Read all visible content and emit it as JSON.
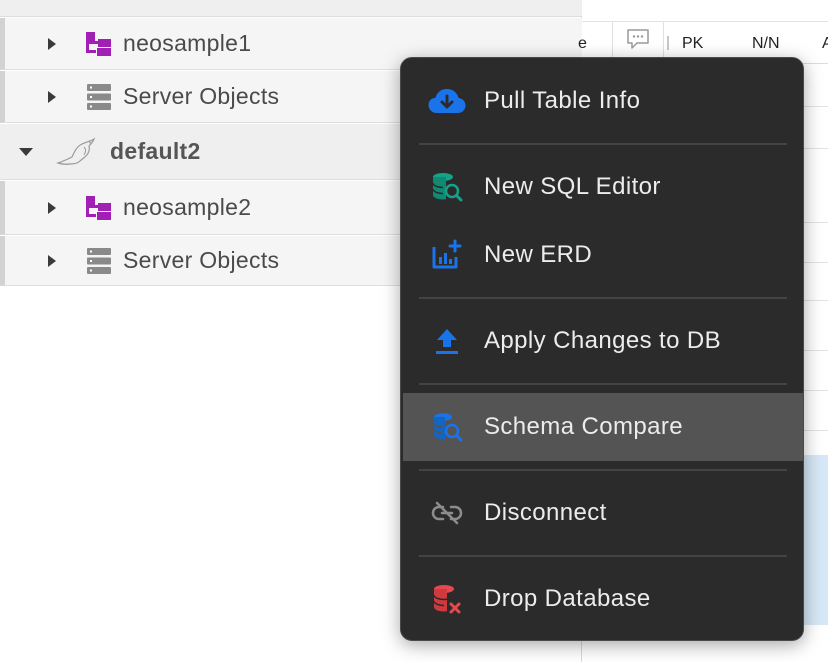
{
  "tree": {
    "items": [
      {
        "label": "neosample1",
        "icon": "schema-icon",
        "level": "child",
        "expanded": false
      },
      {
        "label": "Server Objects",
        "icon": "server-objects-icon",
        "level": "child",
        "expanded": false
      },
      {
        "label": "default2",
        "icon": "mariadb-seal-icon",
        "level": "parent",
        "expanded": true
      },
      {
        "label": "neosample2",
        "icon": "schema-icon",
        "level": "child",
        "expanded": false
      },
      {
        "label": "Server Objects",
        "icon": "server-objects-icon",
        "level": "child",
        "expanded": false
      }
    ]
  },
  "grid": {
    "columns": [
      "e",
      "PK",
      "N/N",
      "A"
    ]
  },
  "context_menu": {
    "items": [
      {
        "label": "Pull Table Info",
        "icon": "cloud-download-icon"
      },
      {
        "label": "New SQL Editor",
        "icon": "database-search-icon"
      },
      {
        "label": "New ERD",
        "icon": "erd-chart-icon"
      },
      {
        "label": "Apply Changes to DB",
        "icon": "upload-arrow-icon"
      },
      {
        "label": "Schema Compare",
        "icon": "schema-compare-icon",
        "highlighted": true
      },
      {
        "label": "Disconnect",
        "icon": "broken-link-icon"
      },
      {
        "label": "Drop Database",
        "icon": "database-delete-icon"
      }
    ]
  },
  "colors": {
    "accent_blue": "#1a73e8",
    "schema_purple": "#a21fb5",
    "sql_teal": "#14a388",
    "drop_red": "#e5484d",
    "menu_bg": "#2b2b2b",
    "menu_highlight": "#545454"
  }
}
